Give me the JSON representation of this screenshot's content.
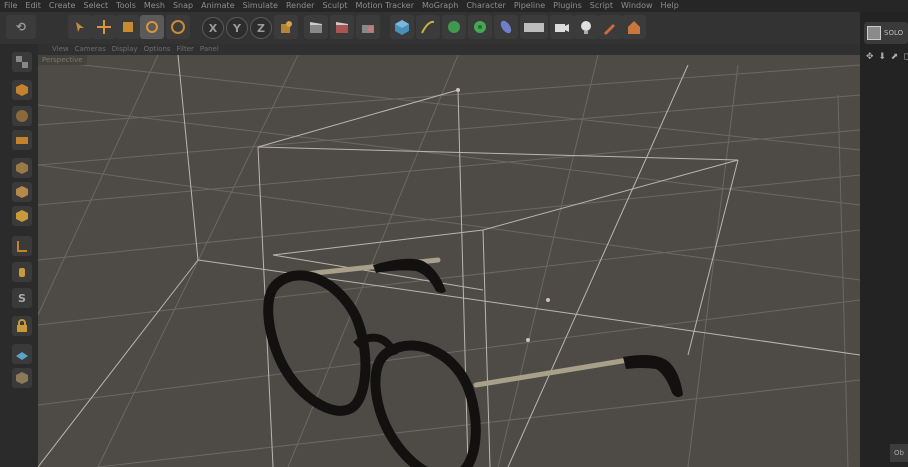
{
  "menubar": {
    "items": [
      "File",
      "Edit",
      "Create",
      "Select",
      "Tools",
      "Mesh",
      "Snap",
      "Animate",
      "Simulate",
      "Render",
      "Sculpt",
      "Motion Tracker",
      "MoGraph",
      "Character",
      "Pipeline",
      "Plugins",
      "Script",
      "Window",
      "Help"
    ]
  },
  "toolbar": {
    "axis_x": "X",
    "axis_y": "Y",
    "axis_z": "Z"
  },
  "viewport_menu": {
    "items": [
      "View",
      "Cameras",
      "Display",
      "Options",
      "Filter",
      "Panel"
    ]
  },
  "viewport": {
    "label": "Perspective"
  },
  "right_panel": {
    "layout_label": "SOLO",
    "nav_arrows": "✥ ⬇ ⬈ ◻",
    "object_tab": "Ob"
  },
  "palette": {
    "sculpt_s": "S"
  },
  "colors": {
    "viewport_bg": "#4e4b47",
    "grid_line": "#6b6863",
    "bbox_line": "#bab5ad",
    "frame_black": "#121110",
    "temple_gold": "#a9a08a"
  },
  "icons": {
    "undo": "undo-icon",
    "move": "move-icon",
    "scale": "scale-icon",
    "rotate": "rotate-icon",
    "cube": "cube-icon",
    "pen": "pen-icon",
    "light": "light-icon",
    "camera": "camera-icon"
  }
}
